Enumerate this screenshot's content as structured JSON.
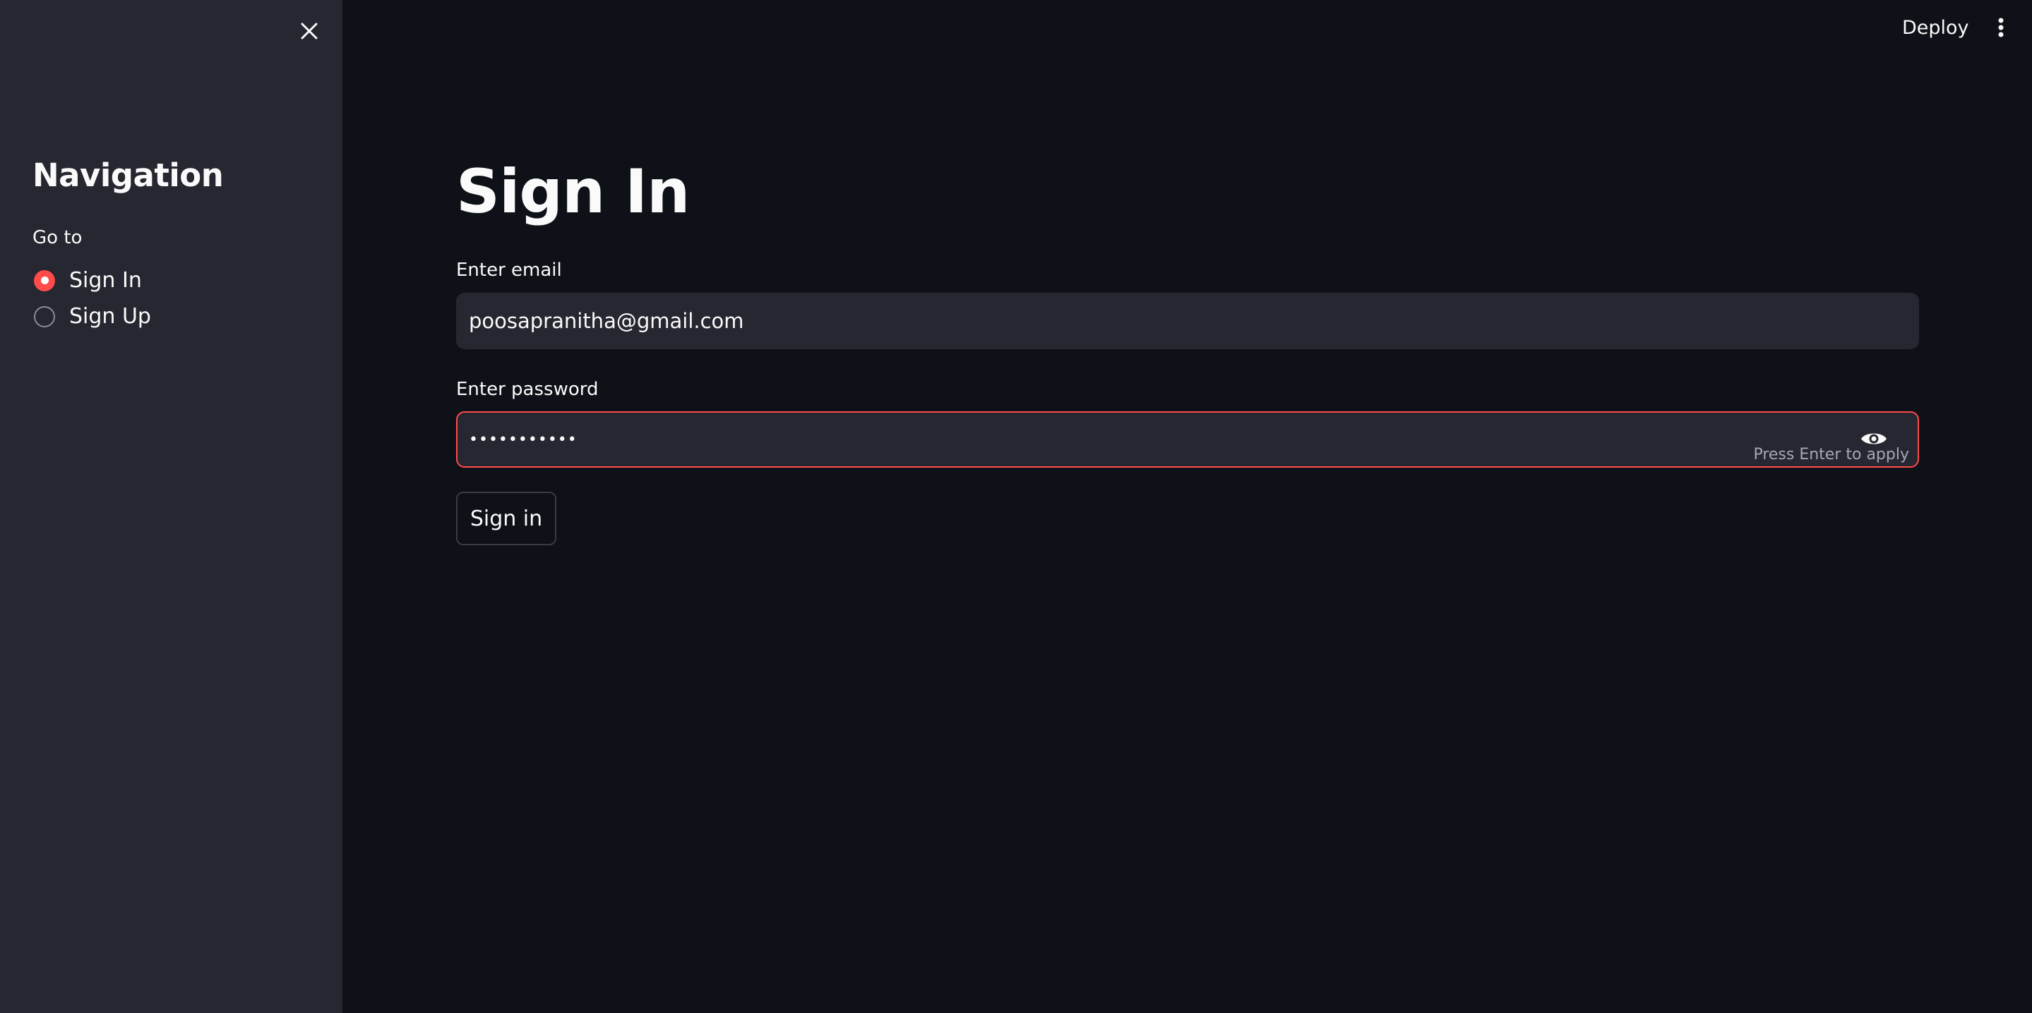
{
  "sidebar": {
    "title": "Navigation",
    "radio_label": "Go to",
    "options": [
      {
        "label": "Sign In",
        "selected": true
      },
      {
        "label": "Sign Up",
        "selected": false
      }
    ],
    "close_icon": "close-icon"
  },
  "header": {
    "deploy_label": "Deploy",
    "menu_icon": "more-vertical-icon"
  },
  "main": {
    "title": "Sign In",
    "email": {
      "label": "Enter email",
      "value": "poosapranitha@gmail.com"
    },
    "password": {
      "label": "Enter password",
      "value": "•••••••••••",
      "hint": "Press Enter to apply",
      "toggle_icon": "eye-icon"
    },
    "submit_label": "Sign in"
  },
  "colors": {
    "accent": "#ff4b4b",
    "background": "#0e1117",
    "sidebar_background": "#262730",
    "text": "#fafafa"
  }
}
